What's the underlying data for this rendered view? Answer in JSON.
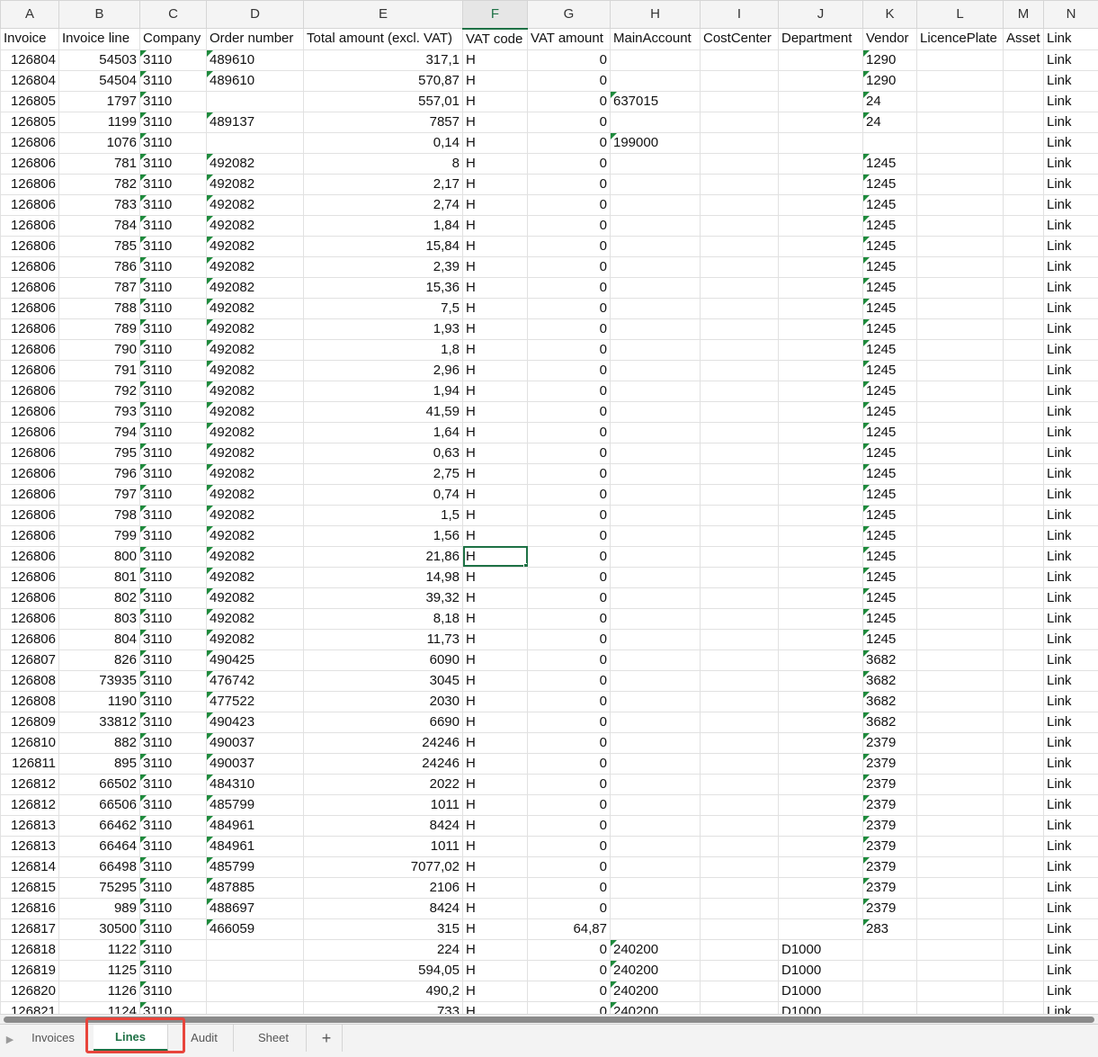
{
  "columns": [
    {
      "letter": "A",
      "header": "Invoice",
      "align": "num"
    },
    {
      "letter": "B",
      "header": "Invoice line",
      "align": "num"
    },
    {
      "letter": "C",
      "header": "Company",
      "align": "txt"
    },
    {
      "letter": "D",
      "header": "Order number",
      "align": "txt"
    },
    {
      "letter": "E",
      "header": "Total amount (excl. VAT)",
      "align": "num"
    },
    {
      "letter": "F",
      "header": "VAT code",
      "align": "txt"
    },
    {
      "letter": "G",
      "header": "VAT amount",
      "align": "num"
    },
    {
      "letter": "H",
      "header": "MainAccount",
      "align": "txt"
    },
    {
      "letter": "I",
      "header": "CostCenter",
      "align": "txt"
    },
    {
      "letter": "J",
      "header": "Department",
      "align": "txt"
    },
    {
      "letter": "K",
      "header": "Vendor",
      "align": "txt"
    },
    {
      "letter": "L",
      "header": "LicencePlate",
      "align": "txt"
    },
    {
      "letter": "M",
      "header": "Asset",
      "align": "txt"
    },
    {
      "letter": "N",
      "header": "Link",
      "align": "txt"
    }
  ],
  "active_column": "F",
  "selected_cell": {
    "row": 24,
    "col": 5
  },
  "rows": [
    [
      "126804",
      "54503",
      "3110",
      "489610",
      "317,1",
      "H",
      "0",
      "",
      "",
      "",
      "1290",
      "",
      "",
      "Link"
    ],
    [
      "126804",
      "54504",
      "3110",
      "489610",
      "570,87",
      "H",
      "0",
      "",
      "",
      "",
      "1290",
      "",
      "",
      "Link"
    ],
    [
      "126805",
      "1797",
      "3110",
      "",
      "557,01",
      "H",
      "0",
      "637015",
      "",
      "",
      "24",
      "",
      "",
      "Link"
    ],
    [
      "126805",
      "1199",
      "3110",
      "489137",
      "7857",
      "H",
      "0",
      "",
      "",
      "",
      "24",
      "",
      "",
      "Link"
    ],
    [
      "126806",
      "1076",
      "3110",
      "",
      "0,14",
      "H",
      "0",
      "199000",
      "",
      "",
      "",
      "",
      "",
      "Link"
    ],
    [
      "126806",
      "781",
      "3110",
      "492082",
      "8",
      "H",
      "0",
      "",
      "",
      "",
      "1245",
      "",
      "",
      "Link"
    ],
    [
      "126806",
      "782",
      "3110",
      "492082",
      "2,17",
      "H",
      "0",
      "",
      "",
      "",
      "1245",
      "",
      "",
      "Link"
    ],
    [
      "126806",
      "783",
      "3110",
      "492082",
      "2,74",
      "H",
      "0",
      "",
      "",
      "",
      "1245",
      "",
      "",
      "Link"
    ],
    [
      "126806",
      "784",
      "3110",
      "492082",
      "1,84",
      "H",
      "0",
      "",
      "",
      "",
      "1245",
      "",
      "",
      "Link"
    ],
    [
      "126806",
      "785",
      "3110",
      "492082",
      "15,84",
      "H",
      "0",
      "",
      "",
      "",
      "1245",
      "",
      "",
      "Link"
    ],
    [
      "126806",
      "786",
      "3110",
      "492082",
      "2,39",
      "H",
      "0",
      "",
      "",
      "",
      "1245",
      "",
      "",
      "Link"
    ],
    [
      "126806",
      "787",
      "3110",
      "492082",
      "15,36",
      "H",
      "0",
      "",
      "",
      "",
      "1245",
      "",
      "",
      "Link"
    ],
    [
      "126806",
      "788",
      "3110",
      "492082",
      "7,5",
      "H",
      "0",
      "",
      "",
      "",
      "1245",
      "",
      "",
      "Link"
    ],
    [
      "126806",
      "789",
      "3110",
      "492082",
      "1,93",
      "H",
      "0",
      "",
      "",
      "",
      "1245",
      "",
      "",
      "Link"
    ],
    [
      "126806",
      "790",
      "3110",
      "492082",
      "1,8",
      "H",
      "0",
      "",
      "",
      "",
      "1245",
      "",
      "",
      "Link"
    ],
    [
      "126806",
      "791",
      "3110",
      "492082",
      "2,96",
      "H",
      "0",
      "",
      "",
      "",
      "1245",
      "",
      "",
      "Link"
    ],
    [
      "126806",
      "792",
      "3110",
      "492082",
      "1,94",
      "H",
      "0",
      "",
      "",
      "",
      "1245",
      "",
      "",
      "Link"
    ],
    [
      "126806",
      "793",
      "3110",
      "492082",
      "41,59",
      "H",
      "0",
      "",
      "",
      "",
      "1245",
      "",
      "",
      "Link"
    ],
    [
      "126806",
      "794",
      "3110",
      "492082",
      "1,64",
      "H",
      "0",
      "",
      "",
      "",
      "1245",
      "",
      "",
      "Link"
    ],
    [
      "126806",
      "795",
      "3110",
      "492082",
      "0,63",
      "H",
      "0",
      "",
      "",
      "",
      "1245",
      "",
      "",
      "Link"
    ],
    [
      "126806",
      "796",
      "3110",
      "492082",
      "2,75",
      "H",
      "0",
      "",
      "",
      "",
      "1245",
      "",
      "",
      "Link"
    ],
    [
      "126806",
      "797",
      "3110",
      "492082",
      "0,74",
      "H",
      "0",
      "",
      "",
      "",
      "1245",
      "",
      "",
      "Link"
    ],
    [
      "126806",
      "798",
      "3110",
      "492082",
      "1,5",
      "H",
      "0",
      "",
      "",
      "",
      "1245",
      "",
      "",
      "Link"
    ],
    [
      "126806",
      "799",
      "3110",
      "492082",
      "1,56",
      "H",
      "0",
      "",
      "",
      "",
      "1245",
      "",
      "",
      "Link"
    ],
    [
      "126806",
      "800",
      "3110",
      "492082",
      "21,86",
      "H",
      "0",
      "",
      "",
      "",
      "1245",
      "",
      "",
      "Link"
    ],
    [
      "126806",
      "801",
      "3110",
      "492082",
      "14,98",
      "H",
      "0",
      "",
      "",
      "",
      "1245",
      "",
      "",
      "Link"
    ],
    [
      "126806",
      "802",
      "3110",
      "492082",
      "39,32",
      "H",
      "0",
      "",
      "",
      "",
      "1245",
      "",
      "",
      "Link"
    ],
    [
      "126806",
      "803",
      "3110",
      "492082",
      "8,18",
      "H",
      "0",
      "",
      "",
      "",
      "1245",
      "",
      "",
      "Link"
    ],
    [
      "126806",
      "804",
      "3110",
      "492082",
      "11,73",
      "H",
      "0",
      "",
      "",
      "",
      "1245",
      "",
      "",
      "Link"
    ],
    [
      "126807",
      "826",
      "3110",
      "490425",
      "6090",
      "H",
      "0",
      "",
      "",
      "",
      "3682",
      "",
      "",
      "Link"
    ],
    [
      "126808",
      "73935",
      "3110",
      "476742",
      "3045",
      "H",
      "0",
      "",
      "",
      "",
      "3682",
      "",
      "",
      "Link"
    ],
    [
      "126808",
      "1190",
      "3110",
      "477522",
      "2030",
      "H",
      "0",
      "",
      "",
      "",
      "3682",
      "",
      "",
      "Link"
    ],
    [
      "126809",
      "33812",
      "3110",
      "490423",
      "6690",
      "H",
      "0",
      "",
      "",
      "",
      "3682",
      "",
      "",
      "Link"
    ],
    [
      "126810",
      "882",
      "3110",
      "490037",
      "24246",
      "H",
      "0",
      "",
      "",
      "",
      "2379",
      "",
      "",
      "Link"
    ],
    [
      "126811",
      "895",
      "3110",
      "490037",
      "24246",
      "H",
      "0",
      "",
      "",
      "",
      "2379",
      "",
      "",
      "Link"
    ],
    [
      "126812",
      "66502",
      "3110",
      "484310",
      "2022",
      "H",
      "0",
      "",
      "",
      "",
      "2379",
      "",
      "",
      "Link"
    ],
    [
      "126812",
      "66506",
      "3110",
      "485799",
      "1011",
      "H",
      "0",
      "",
      "",
      "",
      "2379",
      "",
      "",
      "Link"
    ],
    [
      "126813",
      "66462",
      "3110",
      "484961",
      "8424",
      "H",
      "0",
      "",
      "",
      "",
      "2379",
      "",
      "",
      "Link"
    ],
    [
      "126813",
      "66464",
      "3110",
      "484961",
      "1011",
      "H",
      "0",
      "",
      "",
      "",
      "2379",
      "",
      "",
      "Link"
    ],
    [
      "126814",
      "66498",
      "3110",
      "485799",
      "7077,02",
      "H",
      "0",
      "",
      "",
      "",
      "2379",
      "",
      "",
      "Link"
    ],
    [
      "126815",
      "75295",
      "3110",
      "487885",
      "2106",
      "H",
      "0",
      "",
      "",
      "",
      "2379",
      "",
      "",
      "Link"
    ],
    [
      "126816",
      "989",
      "3110",
      "488697",
      "8424",
      "H",
      "0",
      "",
      "",
      "",
      "2379",
      "",
      "",
      "Link"
    ],
    [
      "126817",
      "30500",
      "3110",
      "466059",
      "315",
      "H",
      "64,87",
      "",
      "",
      "",
      "283",
      "",
      "",
      "Link"
    ],
    [
      "126818",
      "1122",
      "3110",
      "",
      "224",
      "H",
      "0",
      "240200",
      "",
      "D1000",
      "",
      "",
      "",
      "Link"
    ],
    [
      "126819",
      "1125",
      "3110",
      "",
      "594,05",
      "H",
      "0",
      "240200",
      "",
      "D1000",
      "",
      "",
      "",
      "Link"
    ],
    [
      "126820",
      "1126",
      "3110",
      "",
      "490,2",
      "H",
      "0",
      "240200",
      "",
      "D1000",
      "",
      "",
      "",
      "Link"
    ],
    [
      "126821",
      "1124",
      "3110",
      "",
      "733",
      "H",
      "0",
      "240200",
      "",
      "D1000",
      "",
      "",
      "",
      "Link"
    ]
  ],
  "sheet_tabs": [
    {
      "label": "Invoices",
      "active": false
    },
    {
      "label": "Lines",
      "active": true
    },
    {
      "label": "Audit",
      "active": false
    },
    {
      "label": "Sheet",
      "active": false
    }
  ],
  "add_sheet_label": "+",
  "tab_nav_icon": "triangle-right-icon"
}
